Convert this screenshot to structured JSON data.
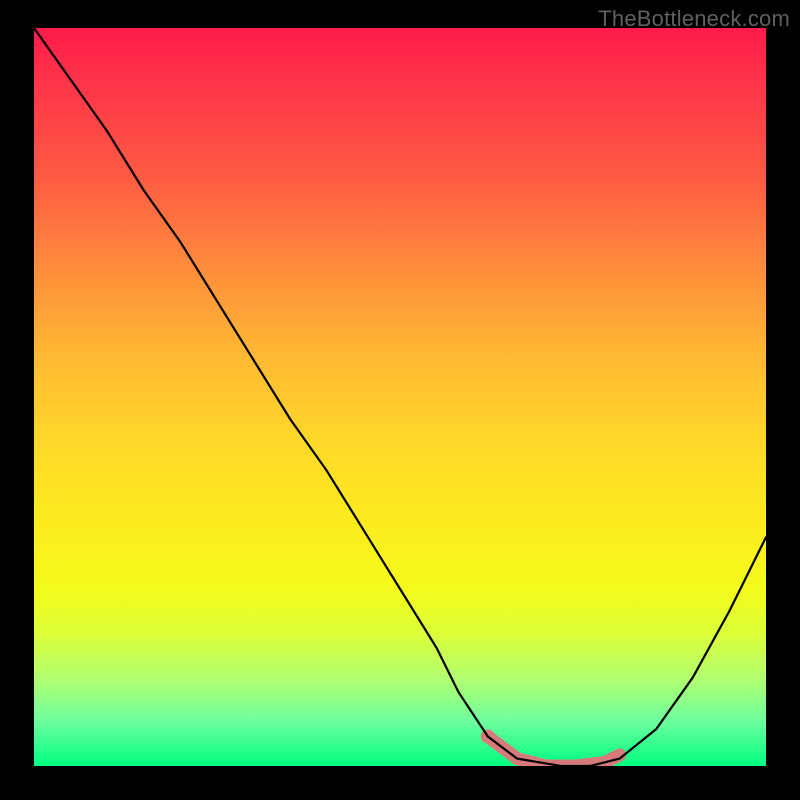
{
  "watermark": "TheBottleneck.com",
  "chart_data": {
    "type": "line",
    "title": "",
    "xlabel": "",
    "ylabel": "",
    "xlim": [
      0,
      100
    ],
    "ylim": [
      0,
      100
    ],
    "series": [
      {
        "name": "bottleneck-curve",
        "x": [
          0,
          5,
          10,
          15,
          20,
          25,
          30,
          35,
          40,
          45,
          50,
          55,
          58,
          62,
          66,
          72,
          76,
          80,
          85,
          90,
          95,
          100
        ],
        "y": [
          100,
          93,
          86,
          78,
          71,
          63,
          55,
          47,
          40,
          32,
          24,
          16,
          10,
          4,
          1,
          0,
          0,
          1,
          5,
          12,
          21,
          31
        ]
      },
      {
        "name": "highlight-band",
        "x": [
          62,
          66,
          70,
          74,
          78,
          80
        ],
        "y": [
          4,
          1,
          0,
          0,
          0.5,
          1.5
        ]
      }
    ],
    "colors": {
      "curve": "#000000",
      "highlight": "#d77a7a"
    }
  }
}
